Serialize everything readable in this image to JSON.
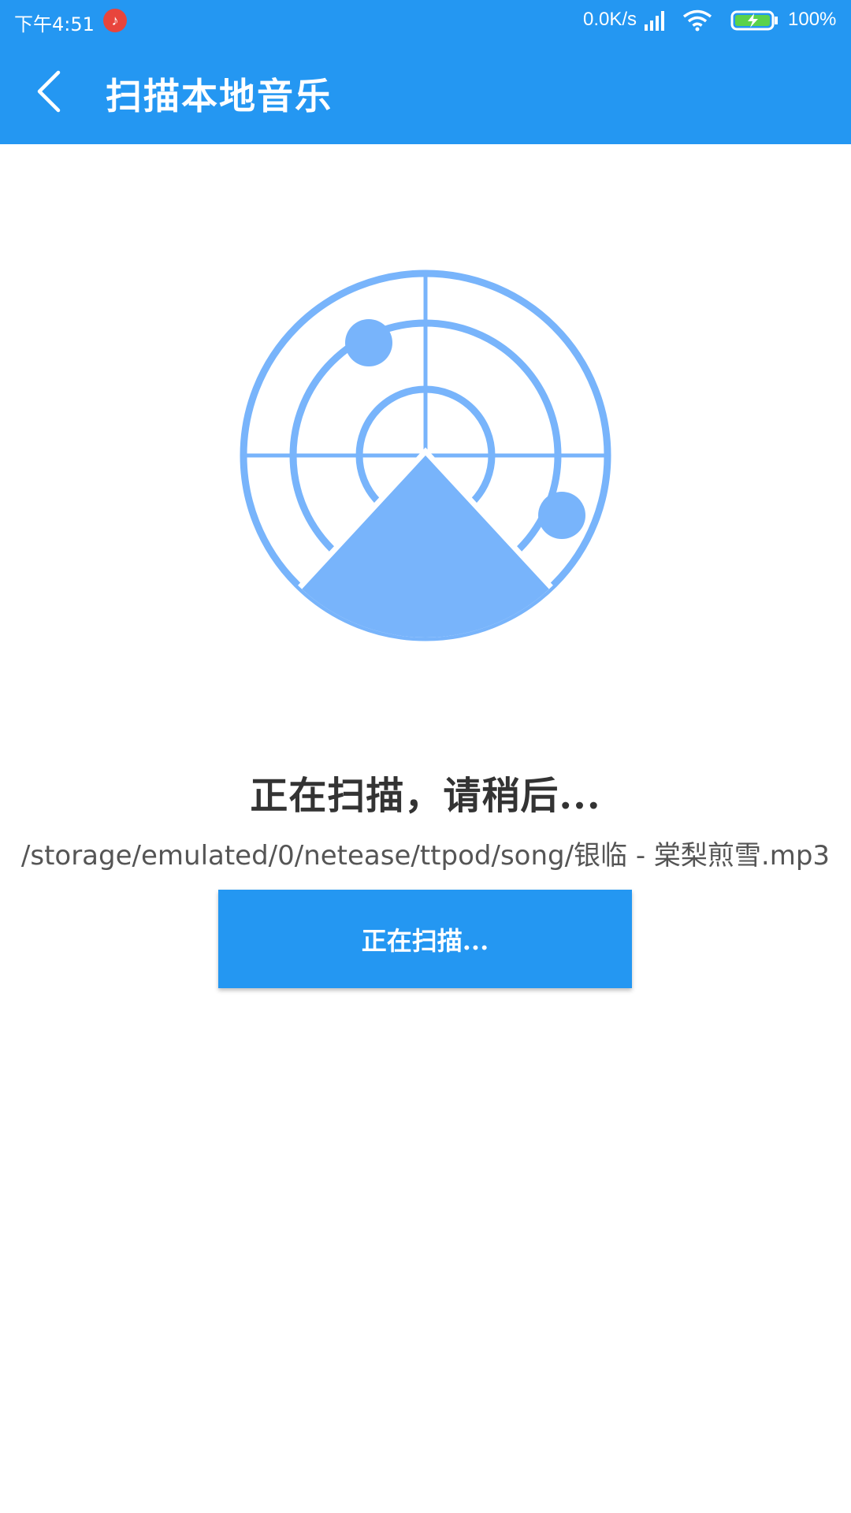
{
  "status_bar": {
    "time": "下午4:51",
    "net_speed": "0.0K/s",
    "battery": "100%",
    "notification_icon": "music-note-icon"
  },
  "app_bar": {
    "title": "扫描本地音乐",
    "back_icon": "back-arrow-icon"
  },
  "scan": {
    "status_text": "正在扫描，请稍后...",
    "current_path": "/storage/emulated/0/netease/ttpod/song/银临 - 棠梨煎雪.mp3",
    "button_label": "正在扫描..."
  },
  "colors": {
    "primary": "#2497f2",
    "radar": "#78b4fb",
    "text_dark": "#333333",
    "text_path": "#555555",
    "notification": "#e8453c"
  }
}
